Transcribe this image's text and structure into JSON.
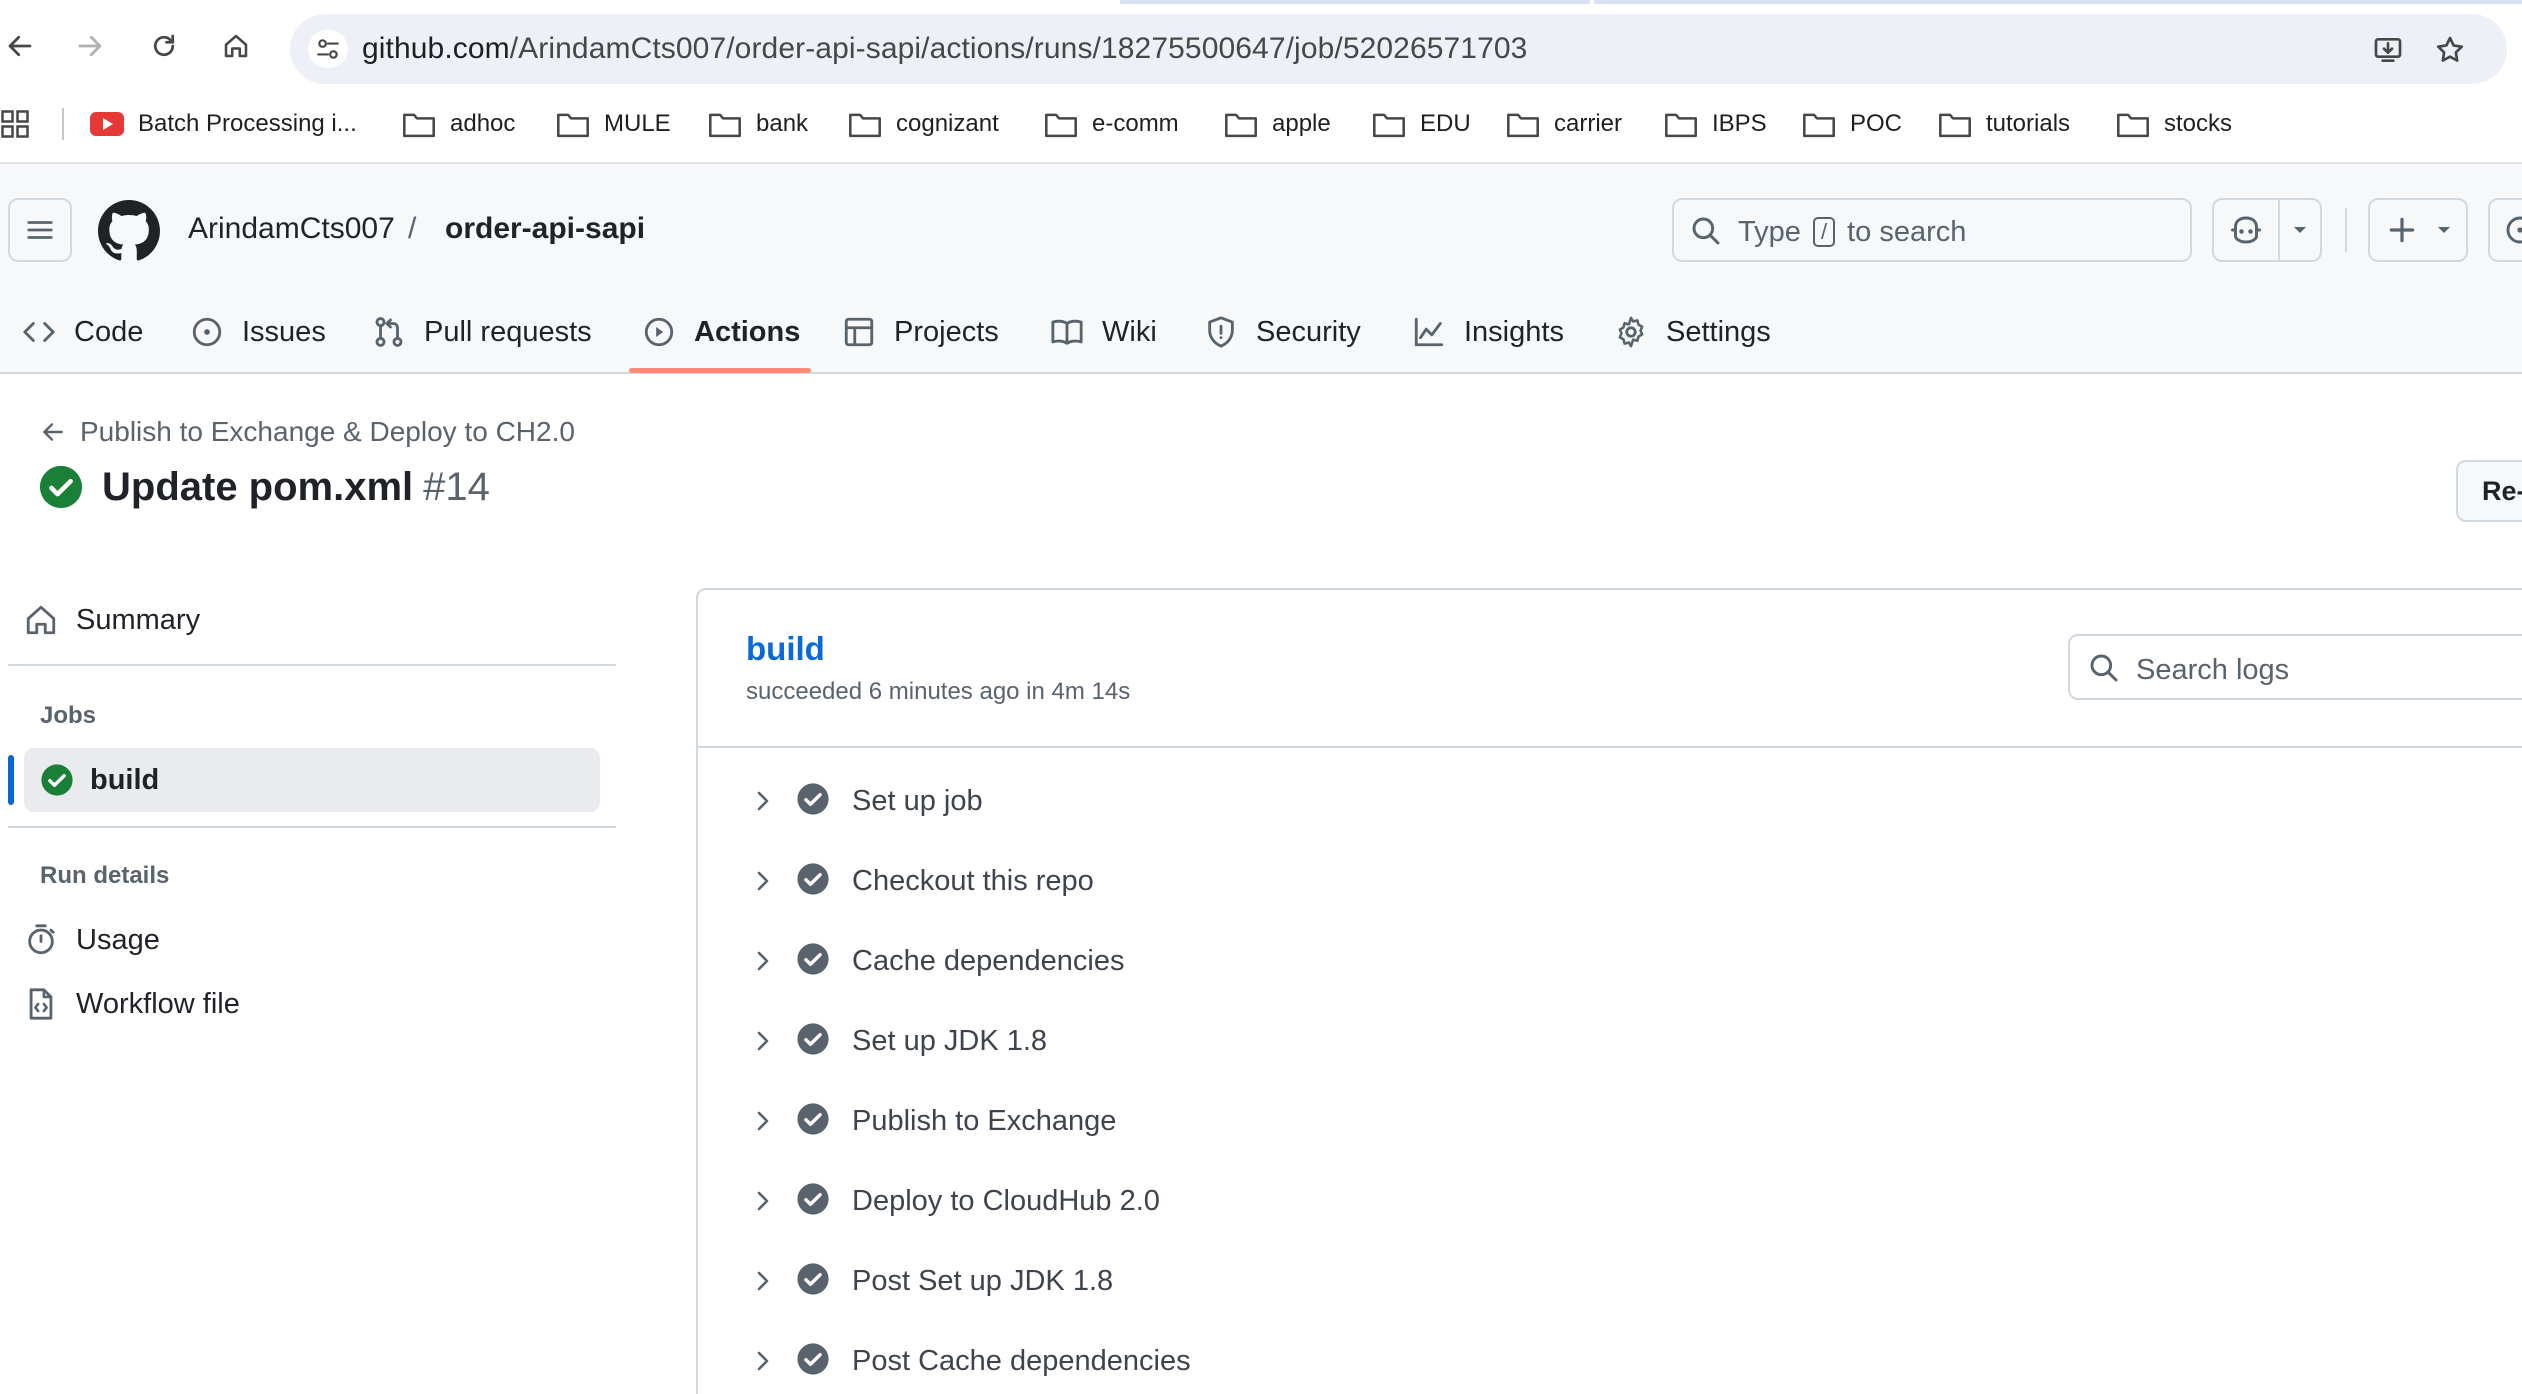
{
  "browser": {
    "url_host": "github.com",
    "url_path": "/ArindamCts007/order-api-sapi/actions/runs/18275500647/job/52026571703",
    "bookmarks": [
      {
        "label": "Batch Processing i...",
        "icon": "youtube-icon"
      },
      {
        "label": "adhoc",
        "icon": "folder-icon"
      },
      {
        "label": "MULE",
        "icon": "folder-icon"
      },
      {
        "label": "bank",
        "icon": "folder-icon"
      },
      {
        "label": "cognizant",
        "icon": "folder-icon"
      },
      {
        "label": "e-comm",
        "icon": "folder-icon"
      },
      {
        "label": "apple",
        "icon": "folder-icon"
      },
      {
        "label": "EDU",
        "icon": "folder-icon"
      },
      {
        "label": "carrier",
        "icon": "folder-icon"
      },
      {
        "label": "IBPS",
        "icon": "folder-icon"
      },
      {
        "label": "POC",
        "icon": "folder-icon"
      },
      {
        "label": "tutorials",
        "icon": "folder-icon"
      },
      {
        "label": "stocks",
        "icon": "folder-icon"
      }
    ]
  },
  "header": {
    "owner": "ArindamCts007",
    "separator": "/",
    "repo": "order-api-sapi",
    "search_prefix": "Type",
    "search_key": "/",
    "search_suffix": "to search"
  },
  "repo_nav": [
    {
      "label": "Code",
      "icon": "code-icon"
    },
    {
      "label": "Issues",
      "icon": "issue-icon"
    },
    {
      "label": "Pull requests",
      "icon": "pull-request-icon"
    },
    {
      "label": "Actions",
      "icon": "play-icon",
      "active": true
    },
    {
      "label": "Projects",
      "icon": "table-icon"
    },
    {
      "label": "Wiki",
      "icon": "book-icon"
    },
    {
      "label": "Security",
      "icon": "shield-icon"
    },
    {
      "label": "Insights",
      "icon": "graph-icon"
    },
    {
      "label": "Settings",
      "icon": "gear-icon"
    }
  ],
  "run": {
    "back_label": "Publish to Exchange & Deploy to CH2.0",
    "title": "Update pom.xml",
    "number": "#14",
    "rerun_label": "Re-run all jobs"
  },
  "sidebar": {
    "summary_label": "Summary",
    "jobs_heading": "Jobs",
    "job_label": "build",
    "run_details_heading": "Run details",
    "usage_label": "Usage",
    "workflow_file_label": "Workflow file"
  },
  "job": {
    "name": "build",
    "meta": "succeeded 6 minutes ago in 4m 14s",
    "search_placeholder": "Search logs",
    "steps": [
      "Set up job",
      "Checkout this repo",
      "Cache dependencies",
      "Set up JDK 1.8",
      "Publish to Exchange",
      "Deploy to CloudHub 2.0",
      "Post Set up JDK 1.8",
      "Post Cache dependencies"
    ]
  },
  "colors": {
    "success": "#1a7f37",
    "step_check": "#59636e",
    "link": "#0969da",
    "active_tab_underline": "#fd8c73"
  }
}
